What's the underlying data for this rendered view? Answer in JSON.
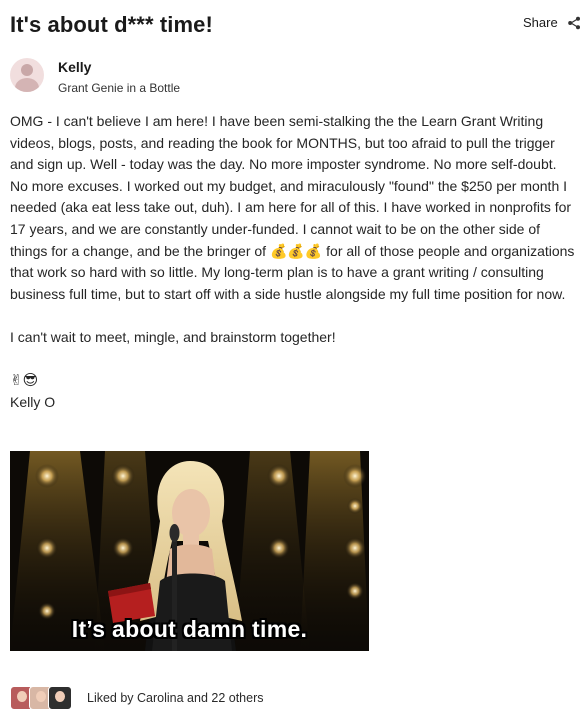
{
  "post": {
    "title": "It's about d*** time!",
    "share_label": "Share"
  },
  "author": {
    "name": "Kelly",
    "role": "Grant Genie in a Bottle"
  },
  "body": {
    "paragraph1": "OMG - I can't believe I am here! I have been semi-stalking the the Learn Grant Writing videos, blogs, posts, and reading the book for MONTHS, but too afraid to pull the trigger and sign up. Well - today was the day. No more imposter syndrome. No more self-doubt. No more excuses. I worked out my budget, and miraculously \"found\" the $250 per month I needed (aka eat less take out, duh). I am here for all of this. I have worked in nonprofits for 17 years, and we are constantly under-funded. I cannot wait to be on the other side of things for a change, and be the bringer of 💰💰💰 for all of those people and organizations that work so hard with so little. My long-term plan is to have a grant writing / consulting business full time, but to start off with a side hustle alongside my full time position for now.",
    "paragraph2": "I can't wait to meet, mingle, and brainstorm together!",
    "emojis": "✌😎",
    "signature": "Kelly O"
  },
  "media": {
    "gif_caption": "It’s about damn time."
  },
  "likes": {
    "text": "Liked by Carolina and 22 others"
  },
  "icons": {
    "share": "share-icon",
    "avatar": "user-avatar"
  }
}
